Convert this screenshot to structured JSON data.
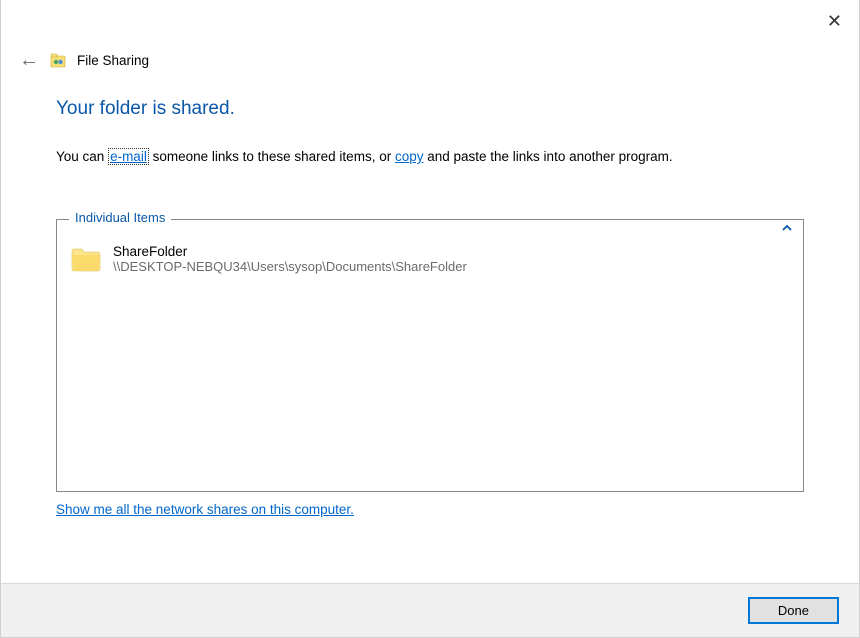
{
  "window": {
    "title": "File Sharing"
  },
  "heading": "Your folder is shared.",
  "description": {
    "prefix": "You can ",
    "email_link": "e-mail",
    "mid1": " someone links to these shared items, or ",
    "copy_link": "copy",
    "suffix": " and paste the links into another program."
  },
  "items_section": {
    "legend": "Individual Items"
  },
  "items": [
    {
      "name": "ShareFolder",
      "path": "\\\\DESKTOP-NEBQU34\\Users\\sysop\\Documents\\ShareFolder"
    }
  ],
  "shares_link": "Show me all the network shares on this computer.",
  "buttons": {
    "done": "Done"
  }
}
